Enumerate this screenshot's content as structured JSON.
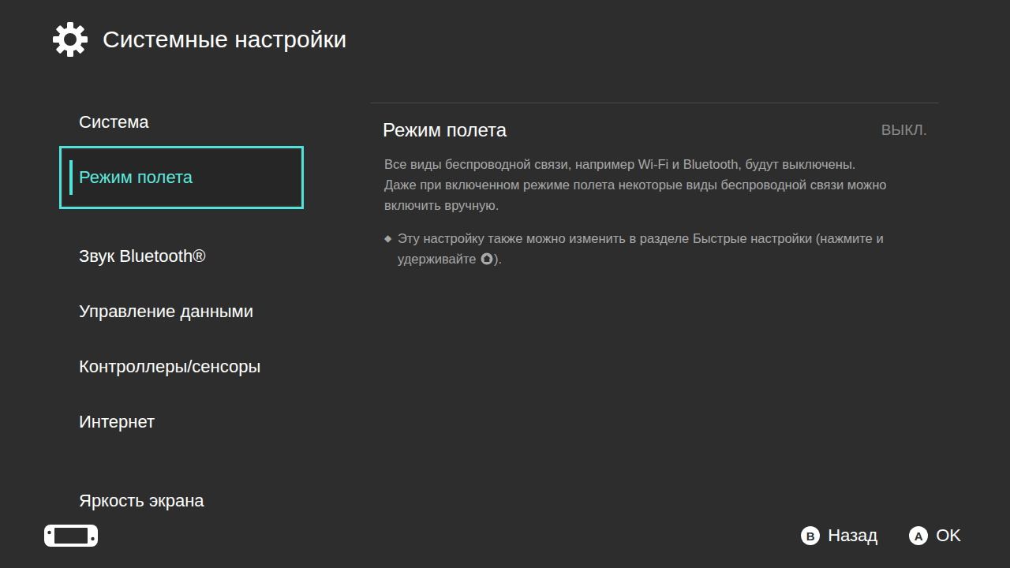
{
  "window": {
    "title": "Системные настройки"
  },
  "sidebar": {
    "groups": [
      [
        {
          "label": "Система",
          "selected": false
        },
        {
          "label": "Режим полета",
          "selected": true
        }
      ],
      [
        {
          "label": "Звук Bluetooth®",
          "selected": false
        },
        {
          "label": "Управление данными",
          "selected": false
        },
        {
          "label": "Контроллеры/сенсоры",
          "selected": false
        },
        {
          "label": "Интернет",
          "selected": false
        }
      ],
      [
        {
          "label": "Яркость экрана",
          "selected": false
        }
      ]
    ]
  },
  "detail": {
    "title": "Режим полета",
    "value": "ВЫКЛ.",
    "on": false,
    "description": [
      "Все виды беспроводной связи, например Wi-Fi и Bluetooth, будут выключены.",
      "Даже при включенном режиме полета некоторые виды беспроводной связи можно включить вручную."
    ],
    "note": {
      "bullet": "◆",
      "text_before": "Эту настройку также можно изменить в разделе Быстрые настройки (нажмите и удерживайте ",
      "text_after": ")."
    }
  },
  "footer": {
    "buttons": [
      {
        "key": "B",
        "label": "Назад"
      },
      {
        "key": "A",
        "label": "OK"
      }
    ]
  }
}
